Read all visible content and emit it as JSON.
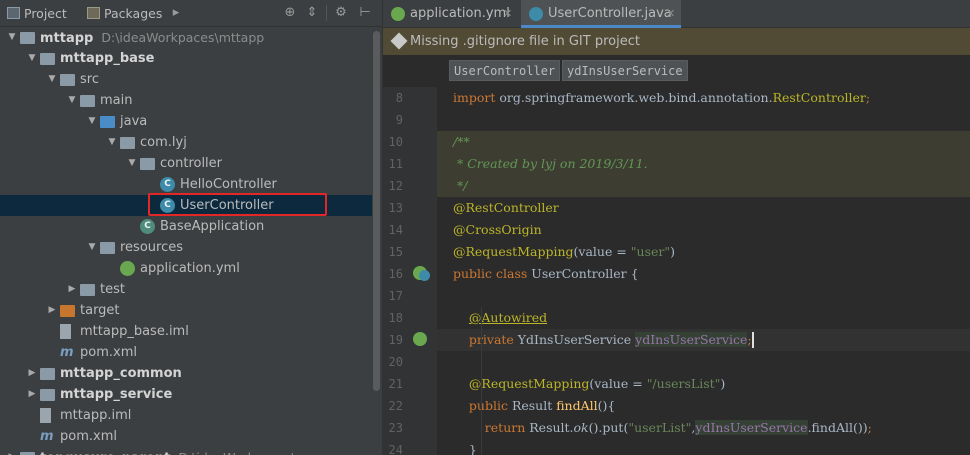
{
  "left_panel": {
    "tabs": [
      {
        "label": "Project",
        "icon": "project-icon"
      },
      {
        "label": "Packages",
        "icon": "packages-icon"
      }
    ],
    "toolbar_icons": [
      "expand-icon",
      "target-icon",
      "collapse-icon",
      "gear-icon",
      "hide-icon"
    ],
    "tree": [
      {
        "label": "mttapp",
        "path": "D:\\ideaWorkpaces\\mttapp",
        "depth": 0,
        "expanded": true,
        "icon": "module-folder-icon",
        "bold": true
      },
      {
        "label": "mttapp_base",
        "depth": 1,
        "expanded": true,
        "icon": "module-folder-icon",
        "bold": true
      },
      {
        "label": "src",
        "depth": 2,
        "expanded": true,
        "icon": "folder-icon"
      },
      {
        "label": "main",
        "depth": 3,
        "expanded": true,
        "icon": "folder-icon"
      },
      {
        "label": "java",
        "depth": 4,
        "expanded": true,
        "icon": "source-folder-icon"
      },
      {
        "label": "com.lyj",
        "depth": 5,
        "expanded": true,
        "icon": "package-icon"
      },
      {
        "label": "controller",
        "depth": 6,
        "expanded": true,
        "icon": "package-icon"
      },
      {
        "label": "HelloController",
        "depth": 7,
        "icon": "class-icon"
      },
      {
        "label": "UserController",
        "depth": 7,
        "icon": "class-icon",
        "selected": true
      },
      {
        "label": "BaseApplication",
        "depth": 6,
        "icon": "spring-boot-class-icon"
      },
      {
        "label": "resources",
        "depth": 4,
        "expanded": true,
        "icon": "resources-folder-icon"
      },
      {
        "label": "application.yml",
        "depth": 5,
        "icon": "yaml-file-icon"
      },
      {
        "label": "test",
        "depth": 3,
        "expanded": false,
        "icon": "folder-icon"
      },
      {
        "label": "target",
        "depth": 2,
        "expanded": false,
        "icon": "excluded-folder-icon"
      },
      {
        "label": "mttapp_base.iml",
        "depth": 2,
        "icon": "iml-file-icon"
      },
      {
        "label": "pom.xml",
        "depth": 2,
        "icon": "maven-file-icon"
      },
      {
        "label": "mttapp_common",
        "depth": 1,
        "expanded": false,
        "icon": "module-folder-icon",
        "bold": true
      },
      {
        "label": "mttapp_service",
        "depth": 1,
        "expanded": false,
        "icon": "module-folder-icon",
        "bold": true
      },
      {
        "label": "mttapp.iml",
        "depth": 1,
        "icon": "iml-file-icon"
      },
      {
        "label": "pom.xml",
        "depth": 1,
        "icon": "maven-file-icon"
      },
      {
        "label": "tengusure_parent",
        "path": "D:\\ideaWorkpaces\\...",
        "depth": 0,
        "expanded": false,
        "icon": "module-folder-icon",
        "bold": true
      }
    ]
  },
  "editor": {
    "tabs": [
      {
        "label": "application.yml",
        "icon": "yaml-file-icon",
        "active": false
      },
      {
        "label": "UserController.java",
        "icon": "class-icon",
        "active": true
      }
    ],
    "banner": "Missing .gitignore file in GIT project",
    "breadcrumbs": [
      "UserController",
      "ydInsUserService"
    ],
    "lines": [
      {
        "n": "8",
        "html": "<span class=\"kw\">import</span> org.springframework.web.bind.annotation.<span class=\"an\">RestController</span><span class=\"kw\">;</span>"
      },
      {
        "n": "9",
        "html": ""
      },
      {
        "n": "10",
        "html": "<span class=\"cm cm-bg\">/**</span>",
        "comment": true
      },
      {
        "n": "11",
        "html": "<span class=\"cm\"> * Created by lyj on 2019/3/11.</span>",
        "comment": true
      },
      {
        "n": "12",
        "html": "<span class=\"cm\"> */</span>",
        "comment": true
      },
      {
        "n": "13",
        "html": "<span class=\"an\">@RestController</span>"
      },
      {
        "n": "14",
        "html": "<span class=\"an\">@CrossOrigin</span>"
      },
      {
        "n": "15",
        "html": "<span class=\"an\">@RequestMapping</span>(value = <span class=\"str\">\"user\"</span>)"
      },
      {
        "n": "16",
        "html": "<span class=\"kw\">public class</span> UserController {"
      },
      {
        "n": "17",
        "html": ""
      },
      {
        "n": "18",
        "html": "    <span class=\"an uline\">@Autowired</span>"
      },
      {
        "n": "19",
        "html": "    <span class=\"kw\">private</span> YdInsUserService <span class=\"fld fldhl\">ydInsUserService</span><span class=\"kw\">;</span>",
        "current": true
      },
      {
        "n": "20",
        "html": ""
      },
      {
        "n": "21",
        "html": "    <span class=\"an\">@RequestMapping</span>(value = <span class=\"str\">\"/usersList\"</span>)"
      },
      {
        "n": "22",
        "html": "    <span class=\"kw\">public</span> Result <span class=\"mtd\">findAll</span>(){"
      },
      {
        "n": "23",
        "html": "        <span class=\"kw\">return</span> Result.<span class=\"st\">ok</span>().put(<span class=\"str\">\"userList\"</span>,<span class=\"fld fldhl\">ydInsUserService</span>.findAll())<span class=\"kw\">;</span>"
      },
      {
        "n": "24",
        "html": "    }"
      }
    ]
  },
  "colors": {
    "panel_bg": "#3c3f41",
    "editor_bg": "#2b2b2b",
    "selection": "#0d293e",
    "highlight_box": "#e32626",
    "keyword": "#cc7832",
    "annotation": "#bbb529",
    "string": "#6a8759",
    "comment": "#629755",
    "field": "#9876aa"
  }
}
